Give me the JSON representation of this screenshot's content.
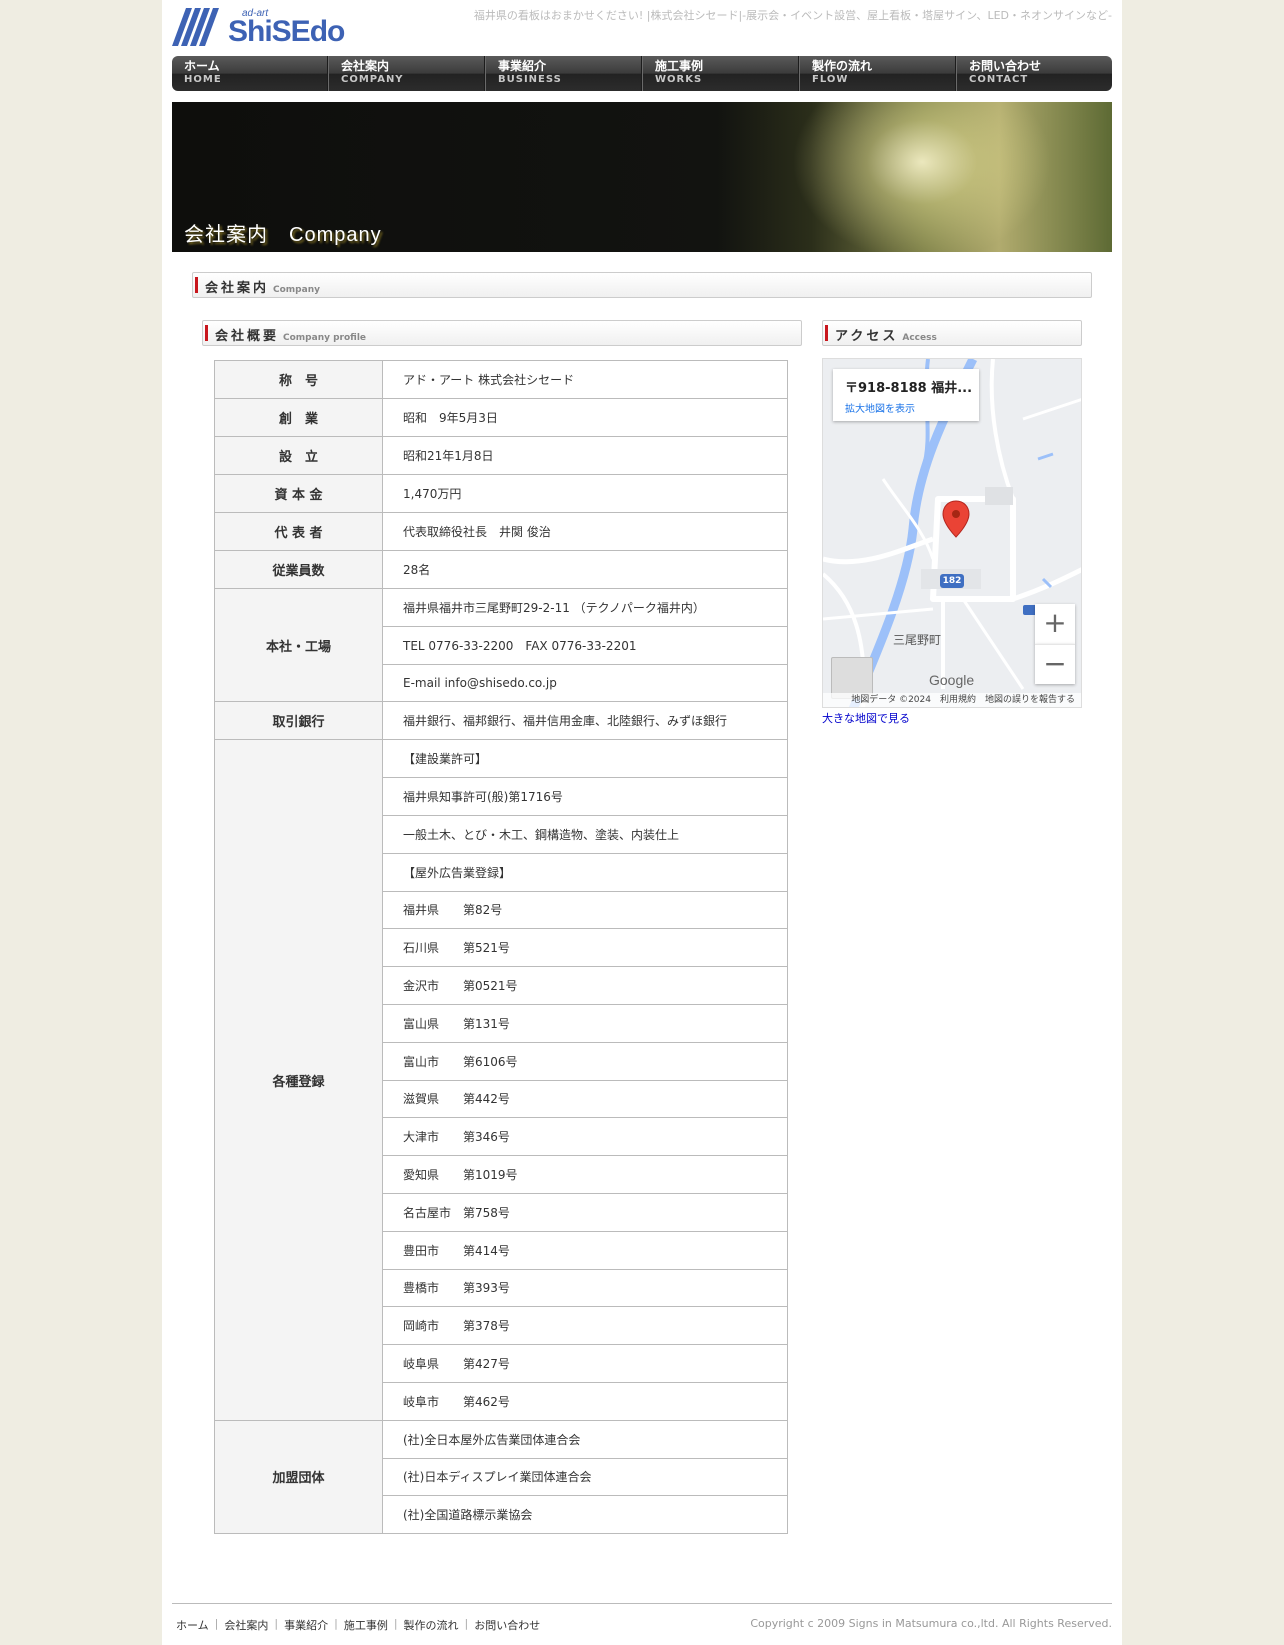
{
  "header": {
    "logo_sub": "ad-art",
    "logo_word": "ShiSEdo",
    "tagline": "福井県の看板はおまかせください! |株式会社シセード|-展示会・イベント設営、屋上看板・塔屋サイン、LED・ネオンサインなど-"
  },
  "nav": [
    {
      "jp": "ホーム",
      "en": "HOME"
    },
    {
      "jp": "会社案内",
      "en": "COMPANY"
    },
    {
      "jp": "事業紹介",
      "en": "BUSINESS"
    },
    {
      "jp": "施工事例",
      "en": "WORKS"
    },
    {
      "jp": "製作の流れ",
      "en": "FLOW"
    },
    {
      "jp": "お問い合わせ",
      "en": "CONTACT"
    }
  ],
  "banner": {
    "title": "会社案内　Company"
  },
  "page_heading": {
    "jp": "会社案内",
    "en": "Company"
  },
  "profile_heading": {
    "jp": "会社概要",
    "en": "Company profile"
  },
  "access_heading": {
    "jp": "アクセス",
    "en": "Access"
  },
  "profile": {
    "rows": [
      {
        "label": "称　号",
        "values": [
          "アド・アート 株式会社シセード"
        ]
      },
      {
        "label": "創　業",
        "values": [
          "昭和　9年5月3日"
        ]
      },
      {
        "label": "設　立",
        "values": [
          "昭和21年1月8日"
        ]
      },
      {
        "label": "資 本 金",
        "values": [
          "1,470万円"
        ]
      },
      {
        "label": "代 表 者",
        "values": [
          "代表取締役社長　井関 俊治"
        ]
      },
      {
        "label": "従業員数",
        "values": [
          "28名"
        ]
      },
      {
        "label": "本社・工場",
        "values": [
          "福井県福井市三尾野町29-2-11 （テクノパーク福井内）",
          "TEL 0776-33-2200　FAX 0776-33-2201",
          "E-mail info@shisedo.co.jp"
        ]
      },
      {
        "label": "取引銀行",
        "values": [
          "福井銀行、福邦銀行、福井信用金庫、北陸銀行、みずほ銀行"
        ]
      },
      {
        "label": "各種登録",
        "values": [
          "【建設業許可】",
          "福井県知事許可(般)第1716号",
          "一般土木、とび・木工、鋼構造物、塗装、内装仕上",
          "【屋外広告業登録】",
          "福井県　　第82号",
          "石川県　　第521号",
          "金沢市　　第0521号",
          "富山県　　第131号",
          "富山市　　第6106号",
          "滋賀県　　第442号",
          "大津市　　第346号",
          "愛知県　　第1019号",
          "名古屋市　第758号",
          "豊田市　　第414号",
          "豊橋市　　第393号",
          "岡崎市　　第378号",
          "岐阜県　　第427号",
          "岐阜市　　第462号"
        ]
      },
      {
        "label": "加盟団体",
        "values": [
          "(社)全日本屋外広告業団体連合会",
          "(社)日本ディスプレイ業団体連合会",
          "(社)全国道路標示業協会"
        ]
      }
    ]
  },
  "map": {
    "info_address": "〒918-8188 福井...",
    "info_link": "拡大地図を表示",
    "road_number": "182",
    "town_label": "三尾野町",
    "google_label": "Google",
    "attribution": "地図データ ©2024　利用規約　地図の誤りを報告する",
    "zoom_in": "+",
    "zoom_out": "−",
    "large_map_link": "大きな地図で見る"
  },
  "footer": {
    "links": [
      "ホーム",
      "会社案内",
      "事業紹介",
      "施工事例",
      "製作の流れ",
      "お問い合わせ"
    ],
    "copyright": "Copyright c 2009 Signs in Matsumura co.,ltd. All Rights Reserved."
  },
  "colors": {
    "accent_red": "#c8161d",
    "brand_blue": "#3d62b4",
    "background": "#efede2"
  }
}
